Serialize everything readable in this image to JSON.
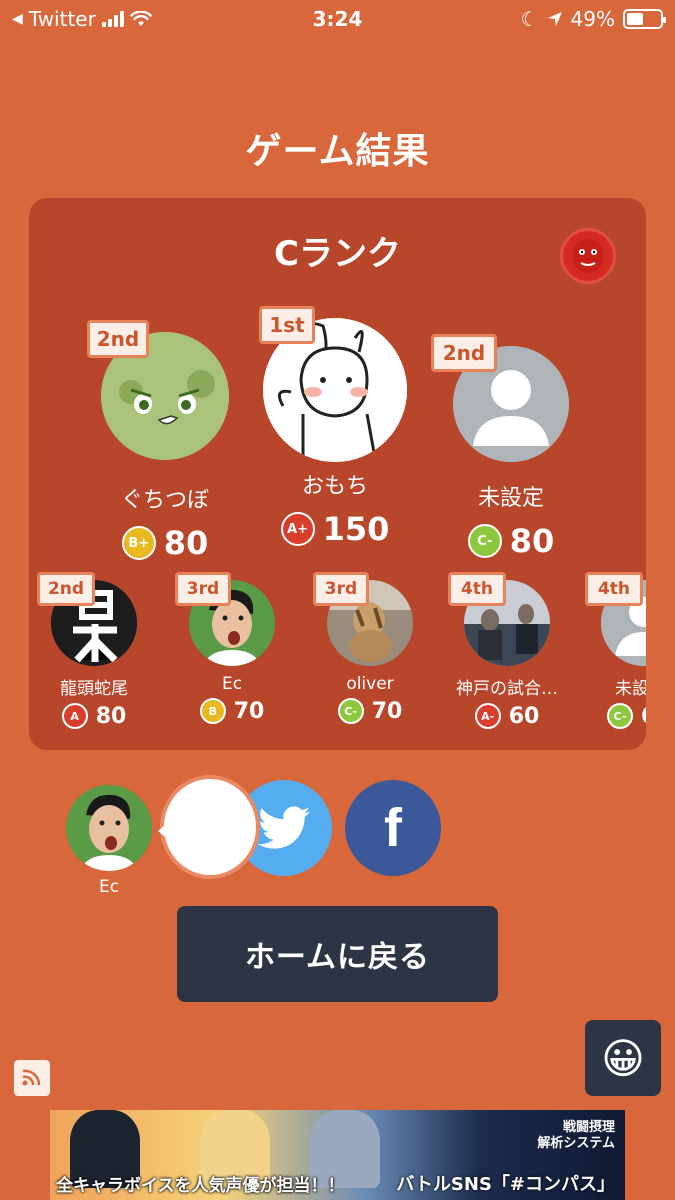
{
  "status_bar": {
    "back_app": "Twitter",
    "time": "3:24",
    "battery": "49%"
  },
  "page_title": "ゲーム結果",
  "rank": {
    "title": "Cランク"
  },
  "top_players": [
    {
      "place": "2nd",
      "name": "ぐちつぼ",
      "grade": "B+",
      "score": "80",
      "avatar_color": "#9fbf6a"
    },
    {
      "place": "1st",
      "name": "おもち",
      "grade": "A+",
      "score": "150",
      "avatar_color": "#ffffff"
    },
    {
      "place": "2nd",
      "name": "未設定",
      "grade": "C-",
      "score": "80",
      "avatar_color": "#aeb4b8"
    }
  ],
  "other_players": [
    {
      "place": "2nd",
      "name": "龍頭蛇尾",
      "grade": "A",
      "score": "80",
      "avatar_color": "#222222"
    },
    {
      "place": "3rd",
      "name": "Ec",
      "grade": "B",
      "score": "70",
      "avatar_color": "#4f8a3c"
    },
    {
      "place": "3rd",
      "name": "oliver",
      "grade": "C-",
      "score": "70",
      "avatar_color": "#8a7a6a"
    },
    {
      "place": "4th",
      "name": "神戸の試合…",
      "grade": "A-",
      "score": "60",
      "avatar_color": "#556070"
    },
    {
      "place": "4th",
      "name": "未設",
      "grade": "C-",
      "score": "6",
      "avatar_color": "#aeb4b8"
    }
  ],
  "reaction": {
    "name": "Ec",
    "emoji": "😭"
  },
  "share": {
    "facebook_label": "f"
  },
  "home_button": "ホームに戻る",
  "emoji_button": "😀",
  "ad": {
    "caption": "全キャラボイスを人気声優が担当！！",
    "brand": "バトルSNS「#コンパス」",
    "top_text": "戦闘摂理\n解析システム"
  }
}
